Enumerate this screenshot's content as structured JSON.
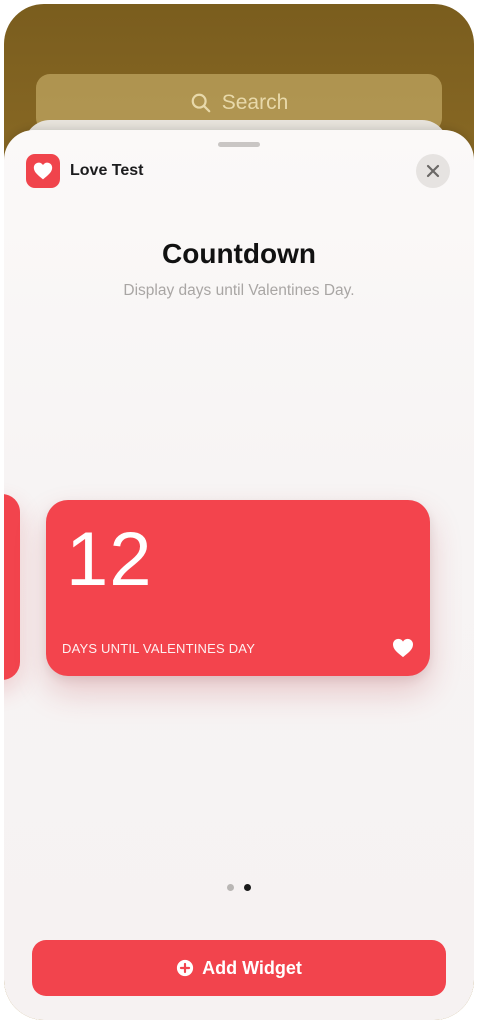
{
  "search": {
    "placeholder": "Search",
    "icon": "search-icon"
  },
  "app": {
    "name": "Love Test",
    "icon": "heart-icon",
    "accent_color": "#F2444D"
  },
  "sheet": {
    "title": "Countdown",
    "subtitle": "Display days until Valentines Day.",
    "close_icon": "close-icon"
  },
  "widget": {
    "number": "12",
    "caption": "DAYS UNTIL VALENTINES DAY",
    "icon": "heart-icon"
  },
  "pager": {
    "total_pages": 2,
    "current_page": 2
  },
  "add_button": {
    "label": "Add Widget",
    "icon": "plus-circle-icon"
  }
}
